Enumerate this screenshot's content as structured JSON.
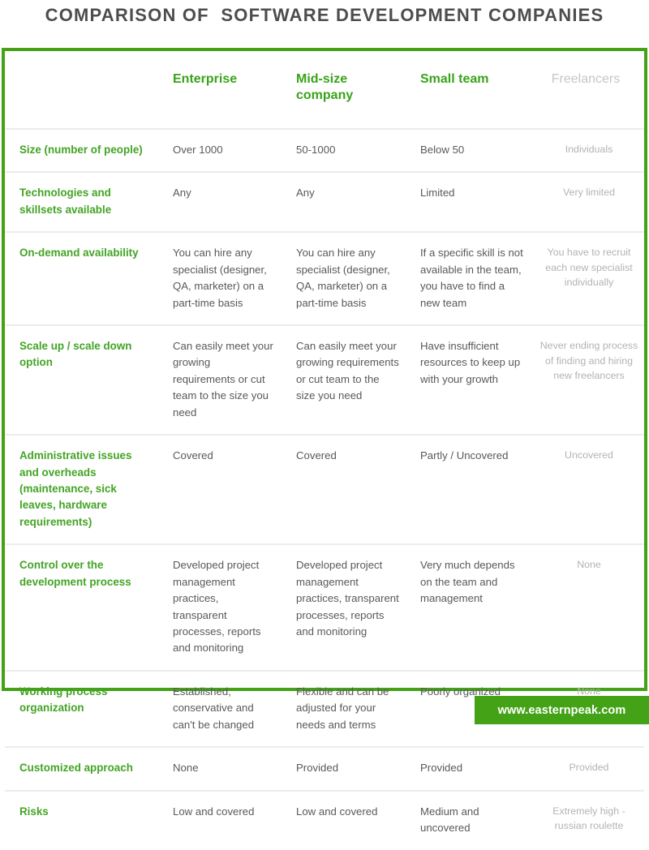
{
  "title": "COMPARISON OF  SOFTWARE DEVELOPMENT COMPANIES",
  "colors": {
    "accent_green": "#43a216",
    "header_green": "#39a319",
    "label_green": "#43a425",
    "body_gray": "#58595b",
    "muted_gray": "#b3b3b3",
    "header_muted_gray": "#c6c6c6",
    "title_gray": "#4d4d4f",
    "row_divider": "#ececec"
  },
  "table": {
    "columns": [
      {
        "key": "label",
        "label": ""
      },
      {
        "key": "enterprise",
        "label": "Enterprise"
      },
      {
        "key": "midsize",
        "label": "Mid-size company"
      },
      {
        "key": "smallteam",
        "label": "Small team"
      },
      {
        "key": "freelancers",
        "label": "Freelancers"
      }
    ],
    "rows": [
      {
        "label": "Size (number of people)",
        "enterprise": "Over 1000",
        "midsize": "50-1000",
        "smallteam": "Below  50",
        "freelancers": "Individuals"
      },
      {
        "label": "Technologies and skillsets available",
        "enterprise": "Any",
        "midsize": "Any",
        "smallteam": "Limited",
        "freelancers": "Very limited"
      },
      {
        "label": "On-demand availability",
        "enterprise": "You can hire any specialist (designer, QA, marketer) on a part-time basis",
        "midsize": "You can hire any specialist (designer, QA, marketer) on a part-time basis",
        "smallteam": "If a specific skill is not available in the team, you have to find a new team",
        "freelancers": "You have to recruit each new specialist individually"
      },
      {
        "label": "Scale up / scale down option",
        "enterprise": "Can easily meet your growing requirements or cut team to the size you need",
        "midsize": "Can easily meet your growing requirements or cut team to the size you need",
        "smallteam": "Have insufficient resources to keep up with your growth",
        "freelancers": "Never ending process of finding and hiring new freelancers"
      },
      {
        "label": "Administrative issues and overheads (maintenance, sick leaves, hardware requirements)",
        "enterprise": "Covered",
        "midsize": "Covered",
        "smallteam": "Partly / Uncovered",
        "freelancers": "Uncovered"
      },
      {
        "label": "Control over the development process",
        "enterprise": "Developed project management practices, transparent processes, reports and monitoring",
        "midsize": "Developed project management practices, transparent processes, reports and monitoring",
        "smallteam": "Very much depends on the team and management",
        "freelancers": "None"
      },
      {
        "label": "Working process organization",
        "enterprise": "Established, conservative and can't be changed",
        "midsize": "Flexible and can be adjusted for your needs and terms",
        "smallteam": "Poorly organized",
        "freelancers": "None"
      },
      {
        "label": "Customized approach",
        "enterprise": "None",
        "midsize": "Provided",
        "smallteam": "Provided",
        "freelancers": "Provided"
      },
      {
        "label": "Risks",
        "enterprise": "Low and covered",
        "midsize": "Low and covered",
        "smallteam": "Medium and uncovered",
        "freelancers": "Extremely high - russian roulette"
      }
    ]
  },
  "footer": {
    "url": "www.easternpeak.com"
  }
}
